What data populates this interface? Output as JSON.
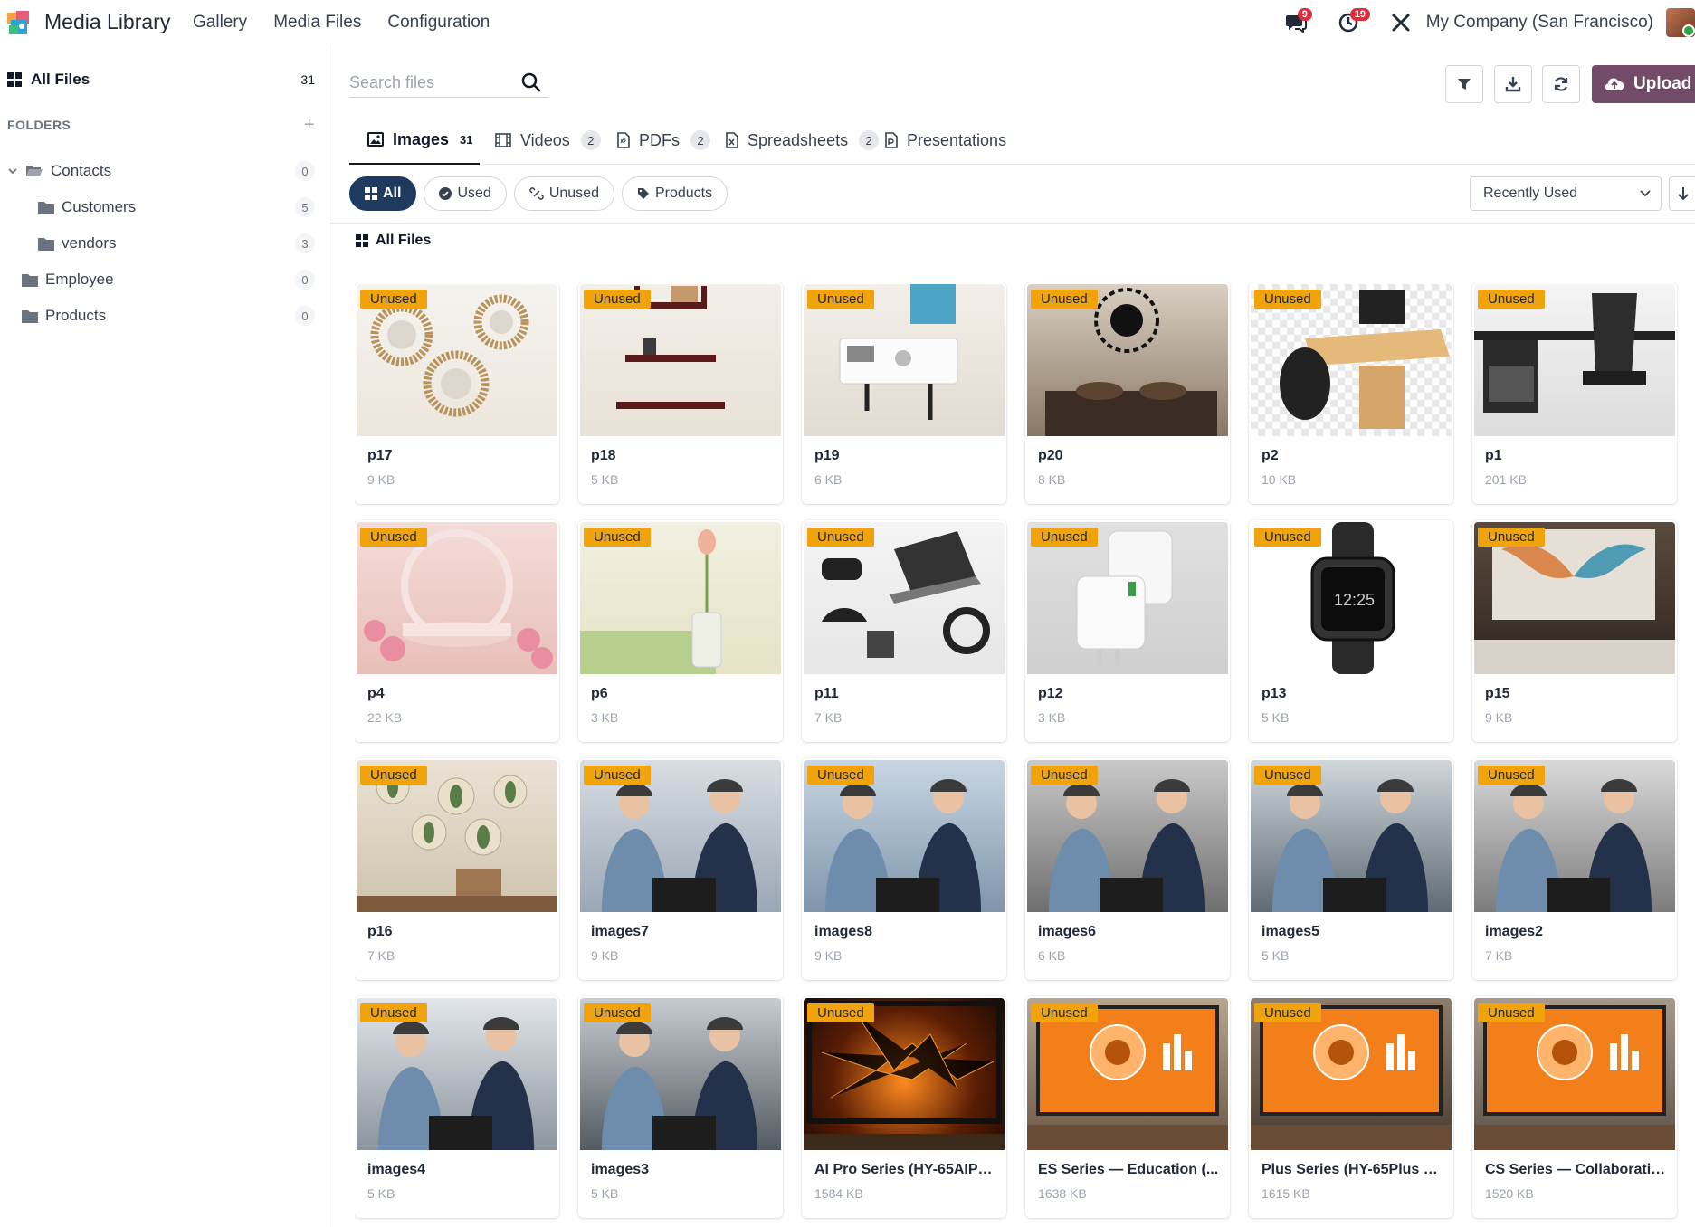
{
  "app": {
    "title": "Media Library",
    "menu": [
      "Gallery",
      "Media Files",
      "Configuration"
    ]
  },
  "systray": {
    "messages_count": "9",
    "activities_count": "19",
    "company": "My Company (San Francisco)"
  },
  "sidebar": {
    "all_files": {
      "label": "All Files",
      "count": "31"
    },
    "folders_header": "FOLDERS",
    "folders": [
      {
        "label": "Contacts",
        "count": "0"
      },
      {
        "label": "Customers",
        "count": "5"
      },
      {
        "label": "vendors",
        "count": "3"
      },
      {
        "label": "Employee",
        "count": "0"
      },
      {
        "label": "Products",
        "count": "0"
      }
    ]
  },
  "search": {
    "placeholder": "Search files"
  },
  "toolbar": {
    "upload_label": "Upload"
  },
  "tabs": [
    {
      "label": "Images",
      "count": "31"
    },
    {
      "label": "Videos",
      "count": "2"
    },
    {
      "label": "PDFs",
      "count": "2"
    },
    {
      "label": "Spreadsheets",
      "count": "2"
    },
    {
      "label": "Presentations",
      "count": ""
    }
  ],
  "filters": [
    "All",
    "Used",
    "Unused",
    "Products"
  ],
  "sort": {
    "selected": "Recently Used"
  },
  "breadcrumb": "All Files",
  "badge_label": "Unused",
  "files": [
    {
      "name": "p17",
      "size": "9 KB"
    },
    {
      "name": "p18",
      "size": "5 KB"
    },
    {
      "name": "p19",
      "size": "6 KB"
    },
    {
      "name": "p20",
      "size": "8 KB"
    },
    {
      "name": "p2",
      "size": "10 KB"
    },
    {
      "name": "p1",
      "size": "201 KB"
    },
    {
      "name": "p4",
      "size": "22 KB"
    },
    {
      "name": "p6",
      "size": "3 KB"
    },
    {
      "name": "p11",
      "size": "7 KB"
    },
    {
      "name": "p12",
      "size": "3 KB"
    },
    {
      "name": "p13",
      "size": "5 KB"
    },
    {
      "name": "p15",
      "size": "9 KB"
    },
    {
      "name": "p16",
      "size": "7 KB"
    },
    {
      "name": "images7",
      "size": "9 KB"
    },
    {
      "name": "images8",
      "size": "9 KB"
    },
    {
      "name": "images6",
      "size": "6 KB"
    },
    {
      "name": "images5",
      "size": "5 KB"
    },
    {
      "name": "images2",
      "size": "7 KB"
    },
    {
      "name": "images4",
      "size": "5 KB"
    },
    {
      "name": "images3",
      "size": "5 KB"
    },
    {
      "name": "AI Pro Series (HY-65AIPR...",
      "size": "1584 KB"
    },
    {
      "name": "ES Series — Education (...",
      "size": "1638 KB"
    },
    {
      "name": "Plus Series (HY-65Plus H...",
      "size": "1615 KB"
    },
    {
      "name": "CS Series — Collaboratio...",
      "size": "1520 KB"
    }
  ],
  "colors": {
    "brand": "#714b67",
    "badge": "#f0a30a",
    "active_chip": "#1e3a5f"
  }
}
